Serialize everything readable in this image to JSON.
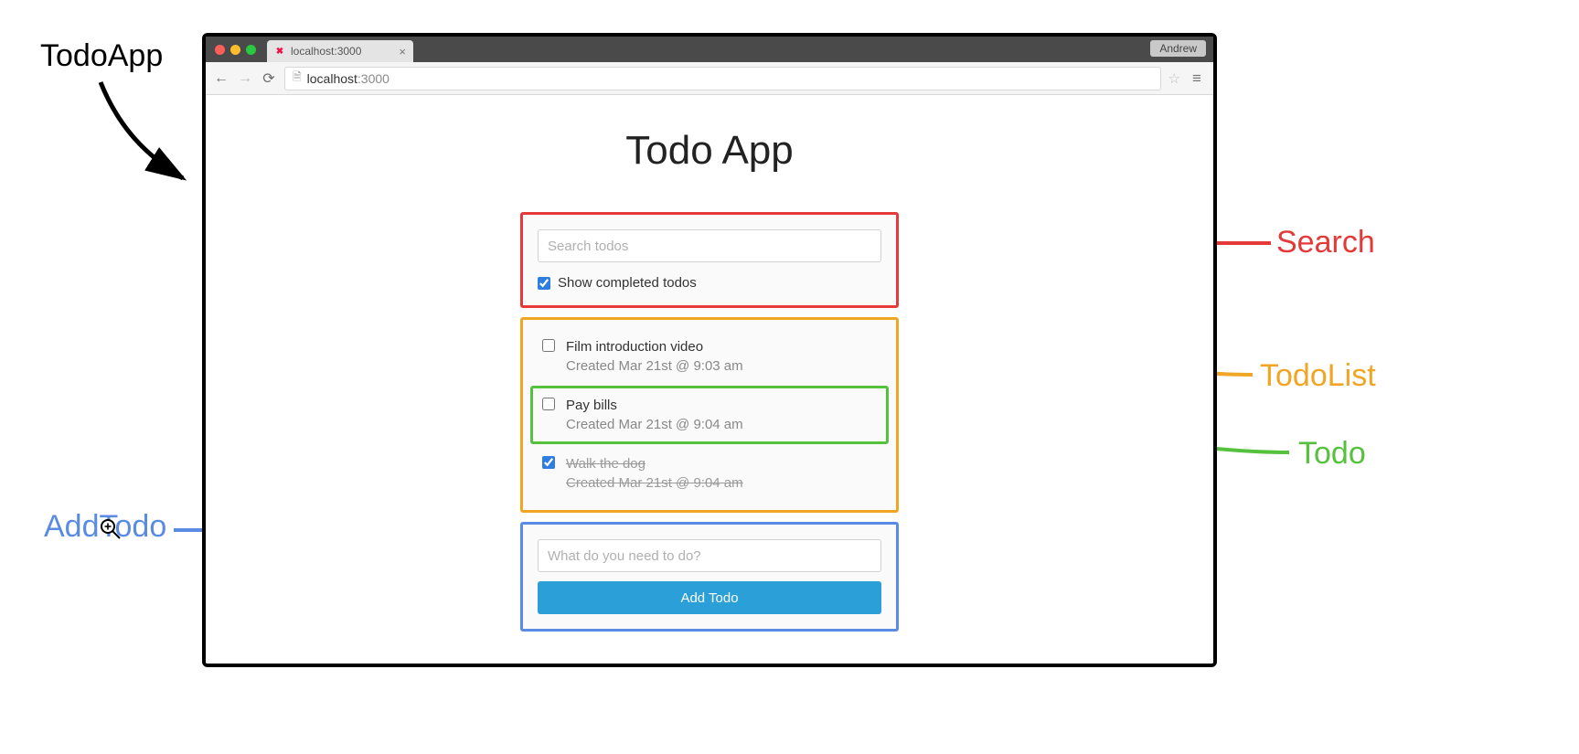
{
  "browser": {
    "tab_title": "localhost:3000",
    "user_badge": "Andrew",
    "url_host": "localhost",
    "url_port": ":3000"
  },
  "app": {
    "title": "Todo App",
    "search": {
      "placeholder": "Search todos",
      "show_completed_label": "Show completed todos",
      "show_completed_checked": true
    },
    "todos": [
      {
        "title": "Film introduction video",
        "meta": "Created Mar 21st @ 9:03 am",
        "done": false,
        "highlight": false
      },
      {
        "title": "Pay bills",
        "meta": "Created Mar 21st @ 9:04 am",
        "done": false,
        "highlight": true
      },
      {
        "title": "Walk the dog",
        "meta": "Created Mar 21st @ 9:04 am",
        "done": true,
        "highlight": false
      }
    ],
    "add": {
      "placeholder": "What do you need to do?",
      "button_label": "Add Todo"
    }
  },
  "annotations": {
    "todoapp": "TodoApp",
    "search": "Search",
    "todolist": "TodoList",
    "todo": "Todo",
    "addtodo": "AddTodo"
  },
  "colors": {
    "search_box": "#e63a3a",
    "list_box": "#f0a624",
    "todo_box": "#55c13d",
    "add_box": "#5a8be3"
  }
}
